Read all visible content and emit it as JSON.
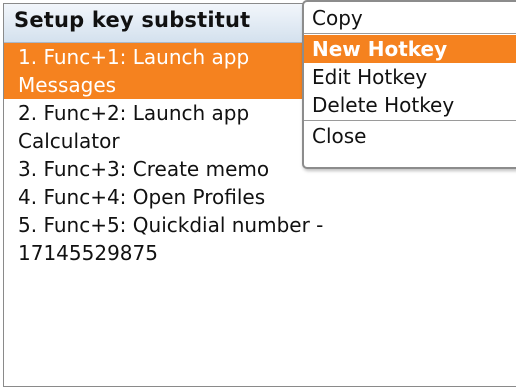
{
  "screen": {
    "title": "Setup key substitut"
  },
  "list": {
    "items": [
      {
        "line1": "1. Func+1: Launch app",
        "line2": "Messages",
        "selected": true
      },
      {
        "line1": "2. Func+2: Launch app",
        "line2": "Calculator",
        "selected": false
      },
      {
        "line1": "3. Func+3: Create memo",
        "line2": "",
        "selected": false
      },
      {
        "line1": "4. Func+4: Open Profiles",
        "line2": "",
        "selected": false
      },
      {
        "line1": "5. Func+5: Quickdial number -",
        "line2": "17145529875",
        "selected": false
      }
    ]
  },
  "menu": {
    "items": [
      {
        "label": "Copy"
      },
      {
        "label": "New Hotkey",
        "highlighted": true
      },
      {
        "label": "Edit Hotkey"
      },
      {
        "label": "Delete Hotkey"
      },
      {
        "label": "Close"
      }
    ]
  },
  "colors": {
    "accent": "#f5821f",
    "title_bar": "#dbe6f1"
  }
}
